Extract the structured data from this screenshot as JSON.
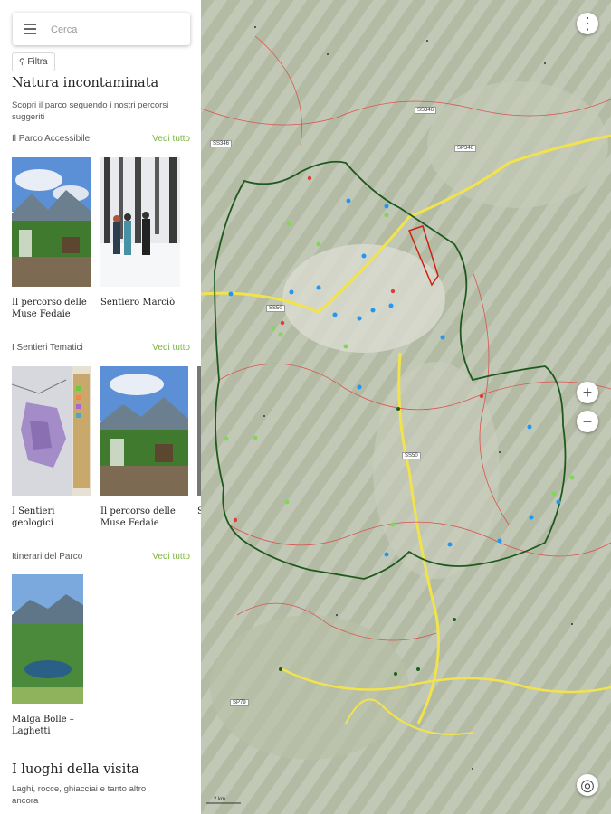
{
  "search": {
    "placeholder": "Cerca"
  },
  "filter": {
    "label": "Filtra"
  },
  "header": {
    "title": "Natura incontaminata",
    "subtitle": "Scopri il parco seguendo i nostri percorsi suggeriti"
  },
  "sections": [
    {
      "title": "Il Parco Accessibile",
      "see_all": "Vedi tutto",
      "cards": [
        {
          "label": "Il percorso delle Muse Fedaie",
          "image": "lake-mountain-photo"
        },
        {
          "label": "Sentiero Marciò",
          "image": "snow-forest-hikers-photo"
        }
      ]
    },
    {
      "title": "I Sentieri Tematici",
      "see_all": "Vedi tutto",
      "cards": [
        {
          "label": "I Sentieri geologici",
          "image": "geological-map-photo"
        },
        {
          "label": "Il percorso delle Muse Fedaie",
          "image": "lake-mountain-photo"
        },
        {
          "label": "S",
          "image": "partial-card"
        }
      ]
    },
    {
      "title": "Itinerari del Parco",
      "see_all": "Vedi tutto",
      "cards": [
        {
          "label": "Malga Bolle – Laghetti",
          "image": "alpine-lake-photo"
        }
      ]
    }
  ],
  "places": {
    "title": "I luoghi della visita",
    "subtitle": "Laghi, rocce, ghiacciai e tanto altro ancora"
  },
  "map": {
    "road_labels": [
      "SS346",
      "SS346",
      "SP346",
      "SS50",
      "SS50",
      "SP79"
    ],
    "scale_label": "2 km",
    "controls": {
      "zoom_in": "+",
      "zoom_out": "−",
      "more": "⋮",
      "locate": "◎"
    },
    "colors": {
      "park_border": "#1e5a1e",
      "trail": "#d9534f",
      "road": "#f2e34d",
      "poi_blue": "#2196f3",
      "poi_green": "#7ed957"
    }
  }
}
